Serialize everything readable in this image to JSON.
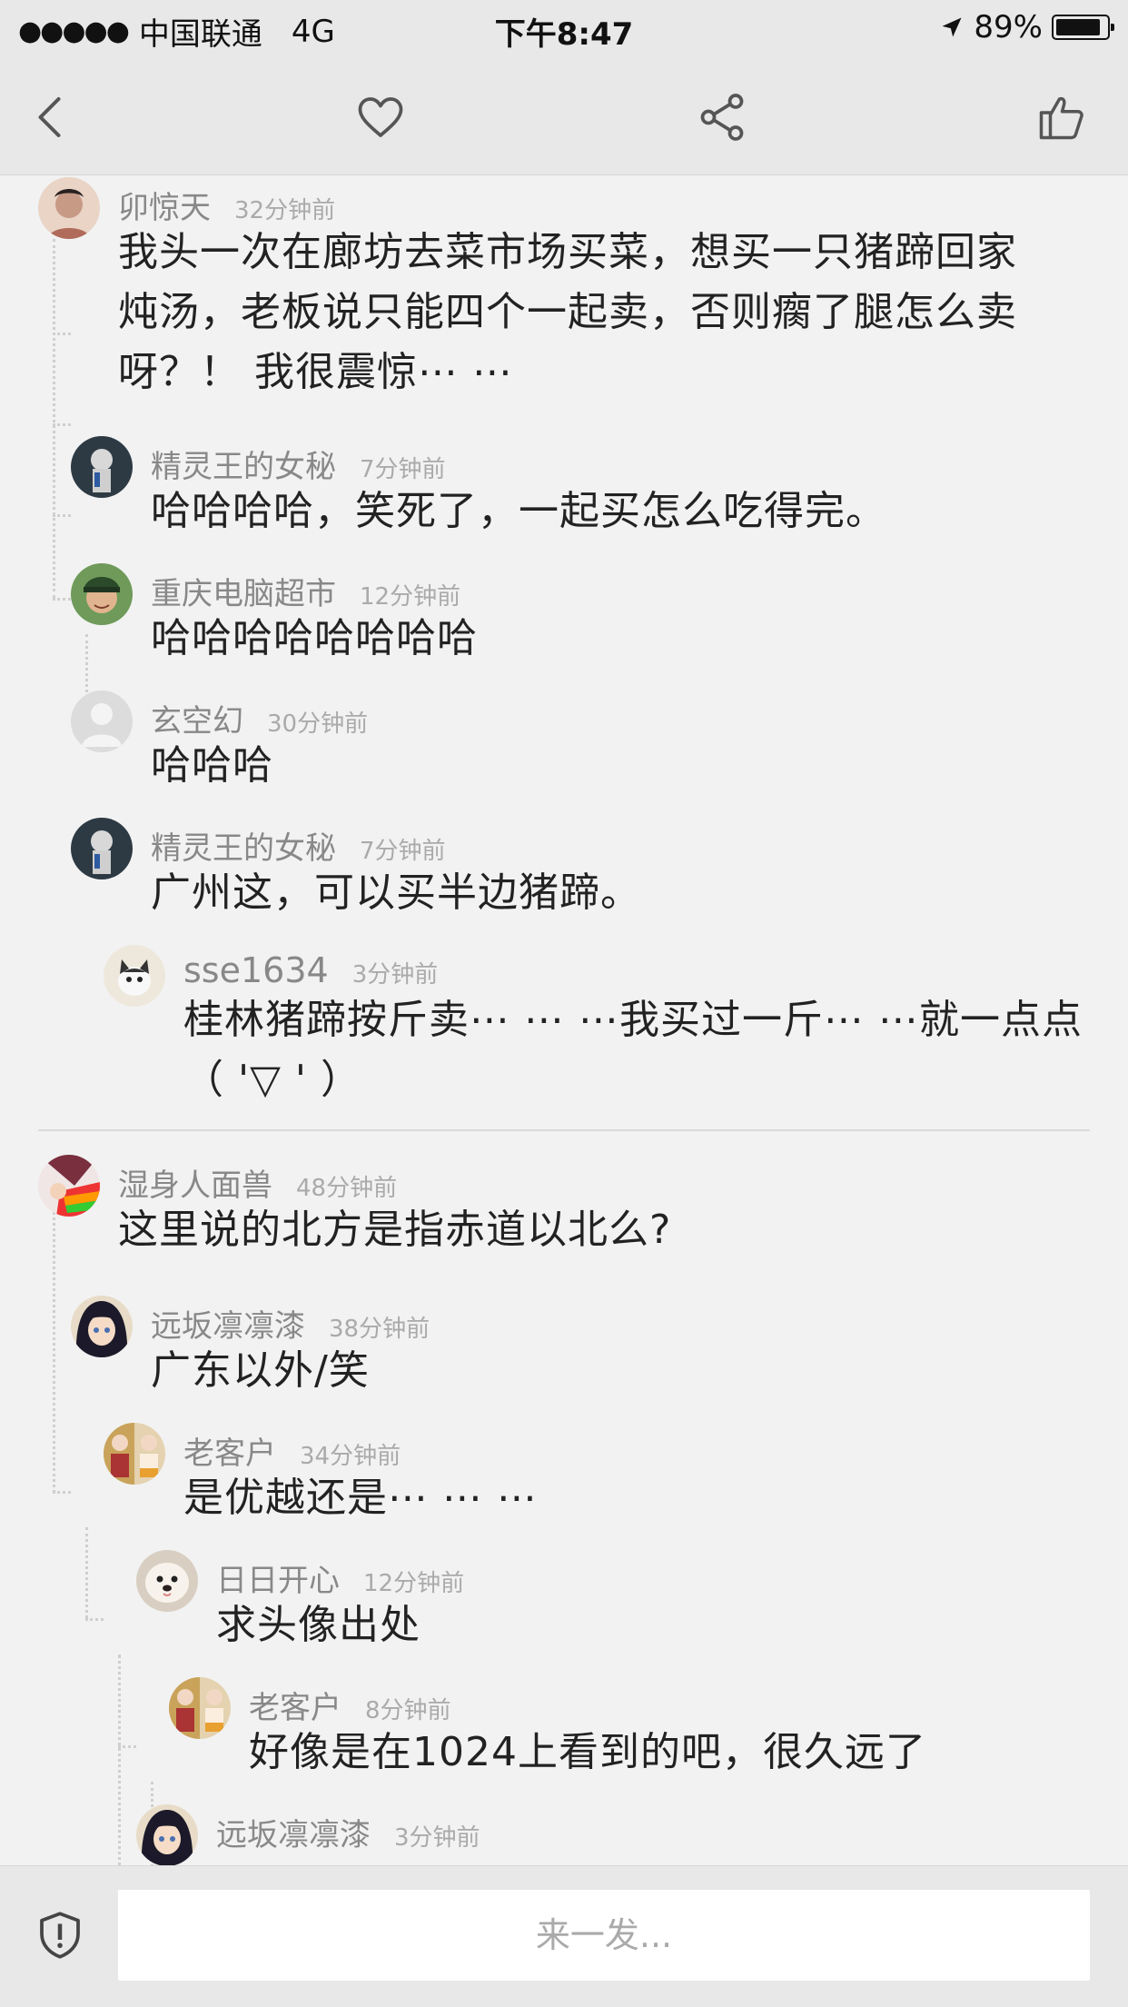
{
  "status_bar": {
    "carrier": "中国联通",
    "network": "4G",
    "time": "下午8:47",
    "battery_percent": "89%",
    "battery_level": 0.89,
    "signal_icon": "signal-dots-icon",
    "location_icon": "location-arrow-icon"
  },
  "nav": {
    "back_icon": "back-chevron-icon",
    "favorite_icon": "heart-icon",
    "share_icon": "share-icon",
    "like_icon": "thumbs-up-icon"
  },
  "threads": [
    {
      "comments": [
        {
          "user": "卯惊天",
          "time": "32分钟前",
          "text_lines": [
            "我头一次在廊坊去菜市场买菜，想买一只猪蹄回家",
            "炖汤，老板说只能四个一起卖，否则瘸了腿怎么卖",
            "呀？！ 我很震惊⋯ ⋯"
          ],
          "avatar_color": "#c79a86"
        },
        {
          "user": "精灵王的女秘",
          "time": "7分钟前",
          "text_lines": [
            "哈哈哈哈，笑死了，一起买怎么吃得完。"
          ],
          "avatar_color": "#3a4a55"
        },
        {
          "user": "重庆电脑超市",
          "time": "12分钟前",
          "text_lines": [
            "哈哈哈哈哈哈哈哈"
          ],
          "avatar_color": "#4a7a3a"
        },
        {
          "user": "玄空幻",
          "time": "30分钟前",
          "text_lines": [
            "哈哈哈"
          ],
          "avatar_color": "#d0d0d0"
        },
        {
          "user": "精灵王的女秘",
          "time": "7分钟前",
          "text_lines": [
            "广州这，可以买半边猪蹄。"
          ],
          "avatar_color": "#3a4a55"
        },
        {
          "user": "sse1634",
          "time": "3分钟前",
          "text_lines": [
            "桂林猪蹄按斤卖⋯ ⋯ ⋯我买过一斤⋯ ⋯就一点点",
            "（ '▽ ' ）"
          ],
          "avatar_color": "#e8e2d6"
        }
      ]
    },
    {
      "comments": [
        {
          "user": "湿身人面兽",
          "time": "48分钟前",
          "text_lines": [
            "这里说的北方是指赤道以北么?"
          ],
          "avatar_color": "#7a2f3f"
        },
        {
          "user": "远坂凛凛漆",
          "time": "38分钟前",
          "text_lines": [
            "广东以外/笑"
          ],
          "avatar_color": "#d8c4a8"
        },
        {
          "user": "老客户",
          "time": "34分钟前",
          "text_lines": [
            "是优越还是⋯ ⋯ ⋯"
          ],
          "avatar_color": "#c9a35a"
        },
        {
          "user": "日日开心",
          "time": "12分钟前",
          "text_lines": [
            "求头像出处"
          ],
          "avatar_color": "#e9e4dc"
        },
        {
          "user": "老客户",
          "time": "8分钟前",
          "text_lines": [
            "好像是在1024上看到的吧，很久远了"
          ],
          "avatar_color": "#c9a35a"
        },
        {
          "user": "远坂凛凛漆",
          "time": "3分钟前",
          "text_lines": [
            ""
          ],
          "avatar_color": "#d8c4a8"
        }
      ]
    }
  ],
  "bottom": {
    "input_placeholder": "来一发...",
    "shield_icon": "shield-icon"
  }
}
